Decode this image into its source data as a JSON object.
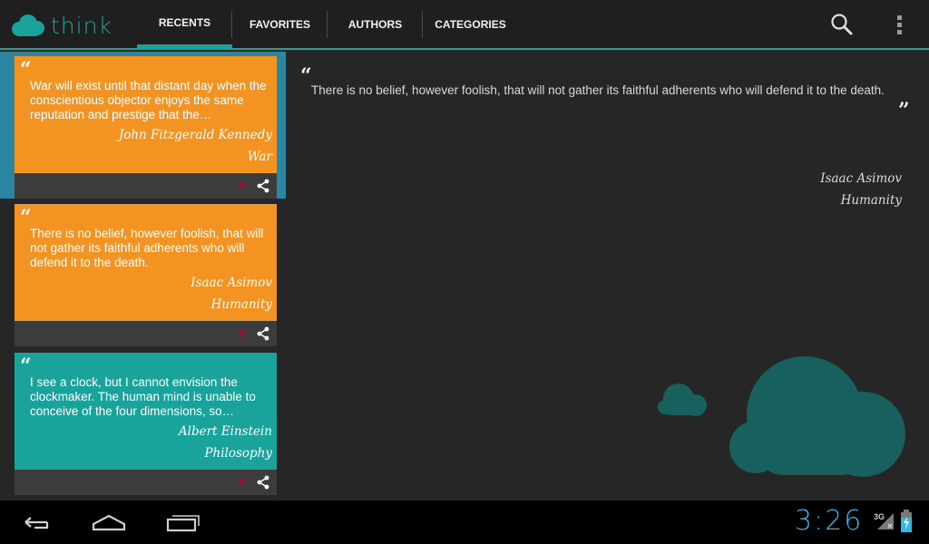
{
  "app": {
    "name": "think",
    "accent_color": "#1aa39b"
  },
  "tabs": [
    {
      "label": "RECENTS",
      "active": true
    },
    {
      "label": "FAVORITES",
      "active": false
    },
    {
      "label": "AUTHORS",
      "active": false
    },
    {
      "label": "CATEGORIES",
      "active": false
    }
  ],
  "actions": {
    "search_icon": "search-icon",
    "overflow_icon": "overflow-menu-icon"
  },
  "quotes": [
    {
      "text": "War will exist until that distant day when the conscientious objector enjoys the same reputation and prestige that the…",
      "author": "John Fitzgerald Kennedy",
      "category": "War",
      "color": "#f39321",
      "selected": true
    },
    {
      "text": "There is no belief, however foolish, that will not gather its faithful adherents who will defend it to the death.",
      "author": "Isaac Asimov",
      "category": "Humanity",
      "color": "#f39321",
      "selected": false
    },
    {
      "text": "I see a clock, but I cannot envision the clockmaker. The human mind is unable to conceive of the four dimensions, so…",
      "author": "Albert Einstein",
      "category": "Philosophy",
      "color": "#1aa39b",
      "selected": false
    }
  ],
  "detail": {
    "text": "There is no belief, however foolish, that will not gather its faithful adherents who will defend it to the death.",
    "author": "Isaac Asimov",
    "category": "Humanity"
  },
  "quote_marks": {
    "open": "“",
    "close": "”"
  },
  "icons": {
    "favorite": "heart-icon",
    "share": "share-icon"
  },
  "heart_glyph": "♥",
  "status": {
    "time": "3:26",
    "network": "3G",
    "clock_color": "#33b5e5"
  },
  "nav": {
    "back": "back-icon",
    "home": "home-icon",
    "recents": "recent-apps-icon"
  }
}
